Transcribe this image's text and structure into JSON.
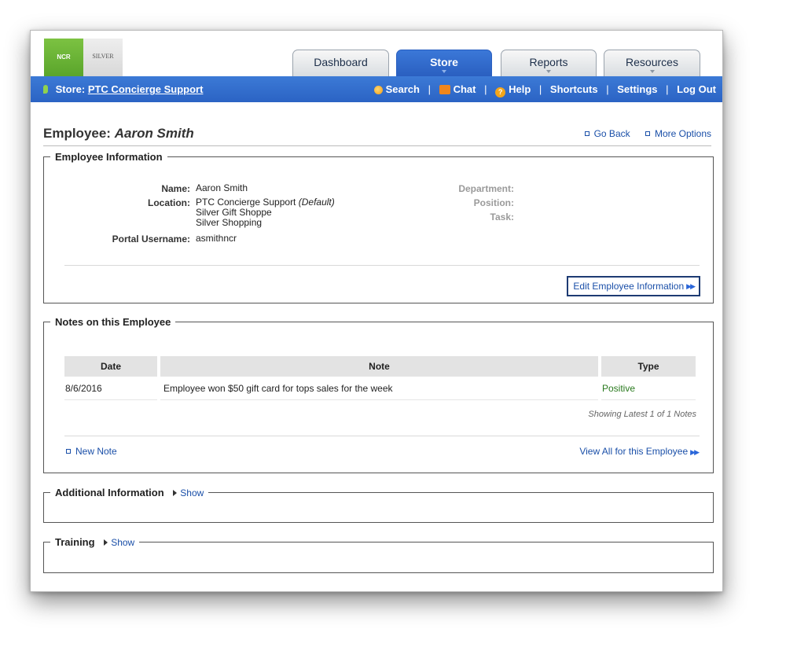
{
  "brand": {
    "ncr": "NCR",
    "silver": "SILVER"
  },
  "tabs": [
    {
      "label": "Dashboard"
    },
    {
      "label": "Store"
    },
    {
      "label": "Reports"
    },
    {
      "label": "Resources"
    }
  ],
  "navbar": {
    "store_prefix": "Store:",
    "store_name": "PTC Concierge Support",
    "links": {
      "search": "Search",
      "chat": "Chat",
      "help": "Help",
      "shortcuts": "Shortcuts",
      "settings": "Settings",
      "logout": "Log Out"
    },
    "sep": "|"
  },
  "page": {
    "title_prefix": "Employee:",
    "title_name": "Aaron Smith",
    "go_back": "Go Back",
    "more_options": "More Options"
  },
  "employee_info": {
    "legend": "Employee Information",
    "name_label": "Name:",
    "name": "Aaron Smith",
    "location_label": "Location:",
    "location_default": "PTC Concierge Support",
    "default_tag": "(Default)",
    "location_2": "Silver Gift Shoppe",
    "location_3": "Silver Shopping",
    "username_label": "Portal Username:",
    "username": "asmithncr",
    "department_label": "Department:",
    "position_label": "Position:",
    "task_label": "Task:",
    "edit_button": "Edit Employee Information"
  },
  "notes": {
    "legend": "Notes on this Employee",
    "columns": {
      "date": "Date",
      "note": "Note",
      "type": "Type"
    },
    "rows": [
      {
        "date": "8/6/2016",
        "note": "Employee won $50 gift card for tops sales for the week",
        "type": "Positive"
      }
    ],
    "showing": "Showing Latest 1 of 1 Notes",
    "new_note": "New Note",
    "view_all": "View All for this Employee"
  },
  "additional": {
    "legend": "Additional Information",
    "show": "Show"
  },
  "training": {
    "legend": "Training",
    "show": "Show"
  },
  "colors": {
    "nav_blue": "#2b63c4",
    "link_blue": "#1a4fa8",
    "positive_green": "#2a7a1e",
    "ncr_green": "#6bb535"
  }
}
